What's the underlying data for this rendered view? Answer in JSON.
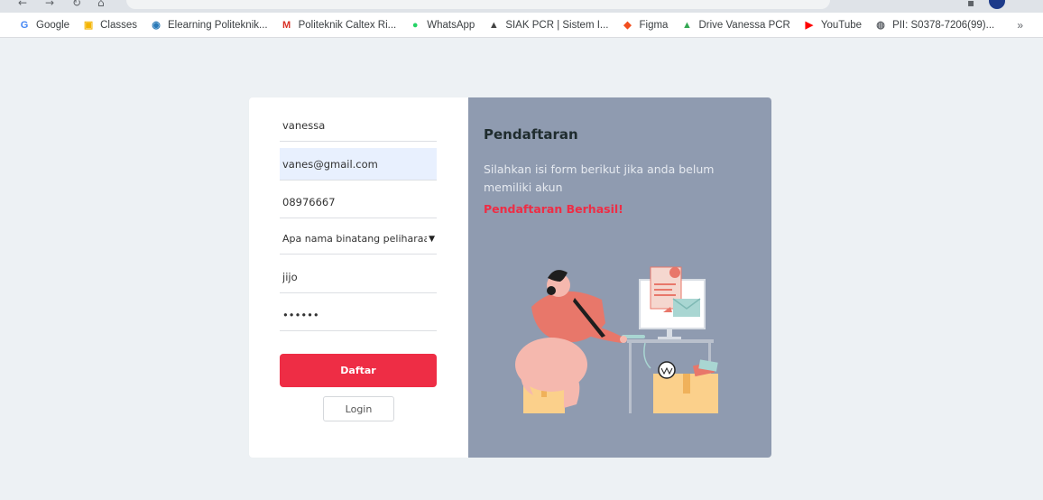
{
  "browser": {
    "url": "",
    "bookmarks": [
      {
        "label": "Google",
        "icon": "google-icon",
        "color": "#4285f4"
      },
      {
        "label": "Classes",
        "icon": "classroom-icon",
        "color": "#f4b400"
      },
      {
        "label": "Elearning Politeknik...",
        "icon": "elearning-icon",
        "color": "#2a7ab8"
      },
      {
        "label": "Politeknik Caltex Ri...",
        "icon": "gmail-icon",
        "color": "#d93025"
      },
      {
        "label": "WhatsApp",
        "icon": "whatsapp-icon",
        "color": "#25d366"
      },
      {
        "label": "SIAK PCR | Sistem I...",
        "icon": "siak-icon",
        "color": "#444444"
      },
      {
        "label": "Figma",
        "icon": "figma-icon",
        "color": "#f24e1e"
      },
      {
        "label": "Drive Vanessa PCR",
        "icon": "drive-icon",
        "color": "#34a853"
      },
      {
        "label": "YouTube",
        "icon": "youtube-icon",
        "color": "#ff0000"
      },
      {
        "label": "PII: S0378-7206(99)...",
        "icon": "globe-icon",
        "color": "#5f6368"
      }
    ],
    "more_label": "»"
  },
  "form": {
    "name_value": "vanessa",
    "email_value": "vanes@gmail.com",
    "phone_value": "08976667",
    "question_selected": "Apa nama binatang peliharaan",
    "answer_value": "jijo",
    "password_value": "123456",
    "submit_label": "Daftar",
    "login_label": "Login"
  },
  "info": {
    "title": "Pendaftaran",
    "description": "Silahkan isi form berikut jika anda belum memiliki akun",
    "success_message": "Pendaftaran Berhasil!"
  },
  "colors": {
    "accent": "#ee2d45",
    "panel": "#8f9bb0",
    "page_background": "#edf1f4"
  }
}
